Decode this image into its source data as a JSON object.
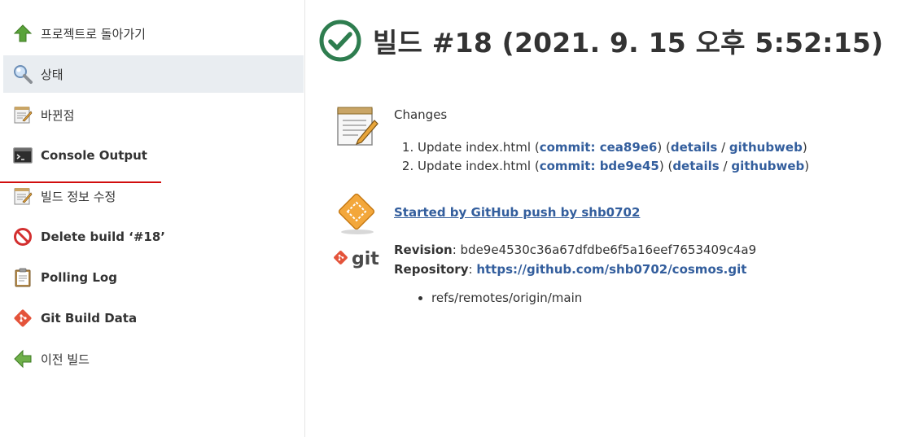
{
  "sidebar": {
    "items": [
      {
        "label": "프로젝트로 돌아가기",
        "icon": "up-arrow-icon"
      },
      {
        "label": "상태",
        "icon": "magnifier-icon"
      },
      {
        "label": "바뀐점",
        "icon": "notepad-icon"
      },
      {
        "label": "Console Output",
        "icon": "terminal-icon"
      },
      {
        "label": "빌드 정보 수정",
        "icon": "notepad-icon"
      },
      {
        "label": "Delete build ‘#18’",
        "icon": "no-entry-icon"
      },
      {
        "label": "Polling Log",
        "icon": "clipboard-icon"
      },
      {
        "label": "Git Build Data",
        "icon": "git-diamond-icon"
      },
      {
        "label": "이전 빌드",
        "icon": "left-arrow-icon"
      }
    ]
  },
  "main": {
    "title": "빌드 #18 (2021. 9. 15 오후 5:52:15)",
    "changes": {
      "title": "Changes",
      "items": [
        {
          "text": "Update index.html",
          "commit": "commit: cea89e6",
          "details": "details",
          "sep": "/",
          "web": "githubweb"
        },
        {
          "text": "Update index.html",
          "commit": "commit: bde9e45",
          "details": "details",
          "sep": "/",
          "web": "githubweb"
        }
      ]
    },
    "started_by": "Started by GitHub push by shb0702",
    "git": {
      "revision_label": "Revision",
      "revision": "bde9e4530c36a67dfdbe6f5a16eef7653409c4a9",
      "repository_label": "Repository",
      "repository": "https://github.com/shb0702/cosmos.git",
      "refs": [
        "refs/remotes/origin/main"
      ],
      "logo_text": "git"
    }
  },
  "colors": {
    "success": "#2e7d4f",
    "link": "#335e9d",
    "active_bg": "#e9edf1",
    "underline": "#d10d0d"
  }
}
